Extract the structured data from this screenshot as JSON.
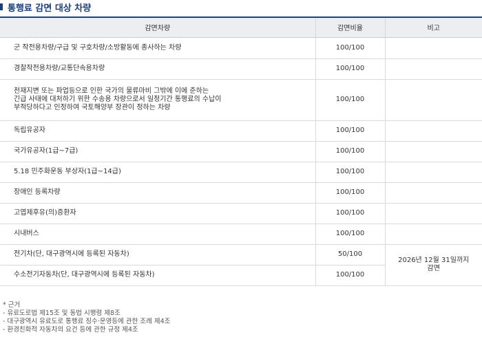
{
  "title": "통행료 감면 대상 차량",
  "table": {
    "headers": [
      "감면차량",
      "감면비율",
      "비고"
    ],
    "rows": [
      {
        "name": "군 작전용차량/구급 및 구호차량/소방활동에 종사하는 차량",
        "rate": "100/100"
      },
      {
        "name": "경찰작전용차량/교통단속용차량",
        "rate": "100/100"
      },
      {
        "name_lines": [
          "천재지변 또는 파업등으로 인한 국가의 물류마비 그밖에 이에 준하는",
          "긴급 사태에 대처하기 위한 수송용 차량으로서 일정기간 통행료의 수납이",
          "부적당하다고 인정하여 국토해양부 장관이 정하는 차량"
        ],
        "rate": "100/100"
      },
      {
        "name": "독립유공자",
        "rate": "100/100"
      },
      {
        "name": "국가유공자(1급~7급)",
        "rate": "100/100"
      },
      {
        "name": "5.18 민주화운동 부상자(1급~14급)",
        "rate": "100/100"
      },
      {
        "name": "장애인 등록차량",
        "rate": "100/100"
      },
      {
        "name": "고엽제후유(의)증환자",
        "rate": "100/100"
      },
      {
        "name": "시내버스",
        "rate": "100/100"
      },
      {
        "name": "전기차(단, 대구광역시에 등록된 자동차)",
        "rate": "50/100"
      },
      {
        "name": "수소전기자동차(단, 대구광역시에 등록된 자동차)",
        "rate": "100/100"
      }
    ],
    "note_lines": [
      "2026년 12월 31일까지",
      "감면"
    ]
  },
  "notes": [
    "* 근거",
    "- 유료도로법 제15조 및 동법 시행령 제8조",
    "- 대구광역시 유료도로 통행료 징수·운영등에 관한 조례 제4조",
    "- 환경친화적 자동차의 요건 등에 관한 규정 제4조"
  ]
}
